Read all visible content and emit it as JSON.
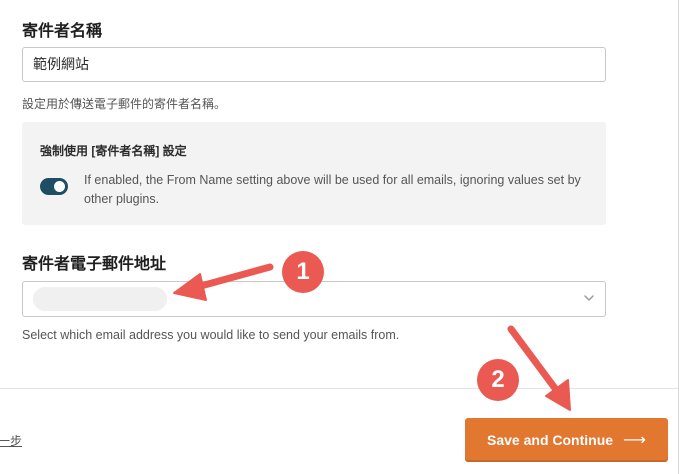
{
  "from_name": {
    "label": "寄件者名稱",
    "value": "範例網站",
    "help": "設定用於傳送電子郵件的寄件者名稱。"
  },
  "force_from_name": {
    "title": "強制使用 [寄件者名稱] 設定",
    "enabled": true,
    "description": "If enabled, the From Name setting above will be used for all emails, ignoring values set by other plugins."
  },
  "from_email": {
    "label": "寄件者電子郵件地址",
    "help": "Select which email address you would like to send your emails from."
  },
  "footer": {
    "back_label": "上一步",
    "continue_label": "Save and Continue",
    "continue_icon": "arrow-right-icon"
  },
  "annotations": {
    "badge_1": "1",
    "badge_2": "2",
    "color": "#ea5a52"
  },
  "colors": {
    "accent": "#e27730",
    "toggle_on": "#1f4e64"
  }
}
